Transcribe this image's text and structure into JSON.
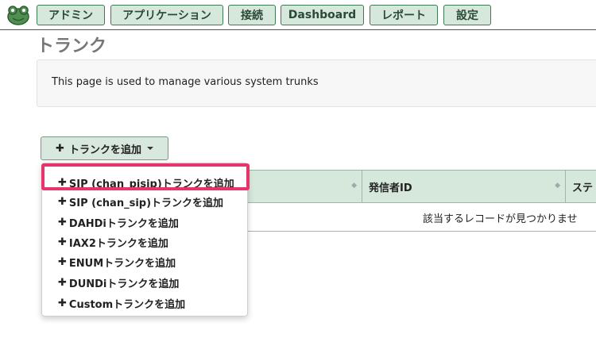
{
  "nav": {
    "items": [
      {
        "label": "アドミン"
      },
      {
        "label": "アプリケーション"
      },
      {
        "label": "接続"
      },
      {
        "label": "Dashboard"
      },
      {
        "label": "レポート"
      },
      {
        "label": "設定"
      }
    ]
  },
  "page": {
    "title": "トランク",
    "description": "This page is used to manage various system trunks"
  },
  "add_trunk": {
    "label": "トランクを追加",
    "plus": "✚",
    "menu": [
      {
        "label": "SIP (chan_pjsip)トランクを追加"
      },
      {
        "label": "SIP (chan_sip)トランクを追加"
      },
      {
        "label": "DAHDiトランクを追加"
      },
      {
        "label": "IAX2トランクを追加"
      },
      {
        "label": "ENUMトランクを追加"
      },
      {
        "label": "DUNDiトランクを追加"
      },
      {
        "label": "Customトランクを追加"
      }
    ]
  },
  "table": {
    "columns": [
      {
        "label": ""
      },
      {
        "label": "発信者ID"
      },
      {
        "label": "ステ"
      }
    ],
    "empty_message": "該当するレコードが見つかりませ"
  },
  "colors": {
    "accent": "#e8336b",
    "nav_bg": "#d6e7dc",
    "header_bg": "#d6e7dc"
  }
}
